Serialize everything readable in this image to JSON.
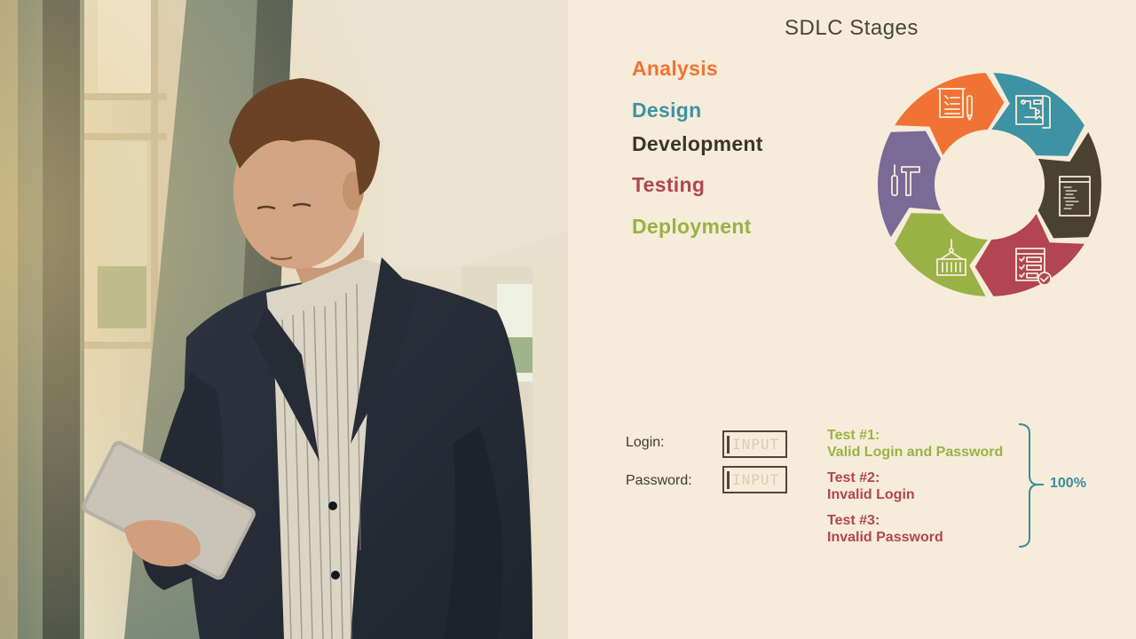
{
  "slide": {
    "title": "SDLC Stages",
    "background_color": "#f7ecda",
    "photo": {
      "description": "Businessman in dark suit looking at a tablet in a bright corridor",
      "icon": "photo-person-tablet"
    }
  },
  "stages": [
    {
      "label": "Analysis",
      "color": "#f07335",
      "icon": "document-checklist-pen-icon"
    },
    {
      "label": "Design",
      "color": "#3d93a3",
      "icon": "blueprint-icon"
    },
    {
      "label": "Development",
      "color": "#3c3529",
      "icon": "code-window-icon"
    },
    {
      "label": "Testing",
      "color": "#b2454f",
      "icon": "test-checklist-icon"
    },
    {
      "label": "Deployment",
      "color": "#98b245",
      "icon": "shipping-container-crane-icon"
    }
  ],
  "cycle": {
    "segments": [
      {
        "name": "analysis",
        "color": "#f07335",
        "icon": "document-checklist-pen-icon"
      },
      {
        "name": "design",
        "color": "#3d93a3",
        "icon": "blueprint-icon"
      },
      {
        "name": "development",
        "color": "#4a4130",
        "icon": "code-window-icon"
      },
      {
        "name": "testing",
        "color": "#b2454f",
        "icon": "test-checklist-icon"
      },
      {
        "name": "deployment",
        "color": "#98b245",
        "icon": "shipping-container-crane-icon"
      },
      {
        "name": "maintenance",
        "color": "#7a6a96",
        "icon": "screwdriver-hammer-icon"
      }
    ]
  },
  "form": {
    "login_label": "Login:",
    "password_label": "Password:",
    "login_placeholder": "INPUT",
    "password_placeholder": "INPUT"
  },
  "tests": [
    {
      "title": "Test #1:",
      "desc": "Valid Login and Password",
      "color": "#98b245"
    },
    {
      "title": "Test #2:",
      "desc": "Invalid Login",
      "color": "#b2454f"
    },
    {
      "title": "Test #3:",
      "desc": "Invalid Password",
      "color": "#b2454f"
    }
  ],
  "coverage": {
    "label": "100%",
    "color": "#3b8d9c"
  }
}
